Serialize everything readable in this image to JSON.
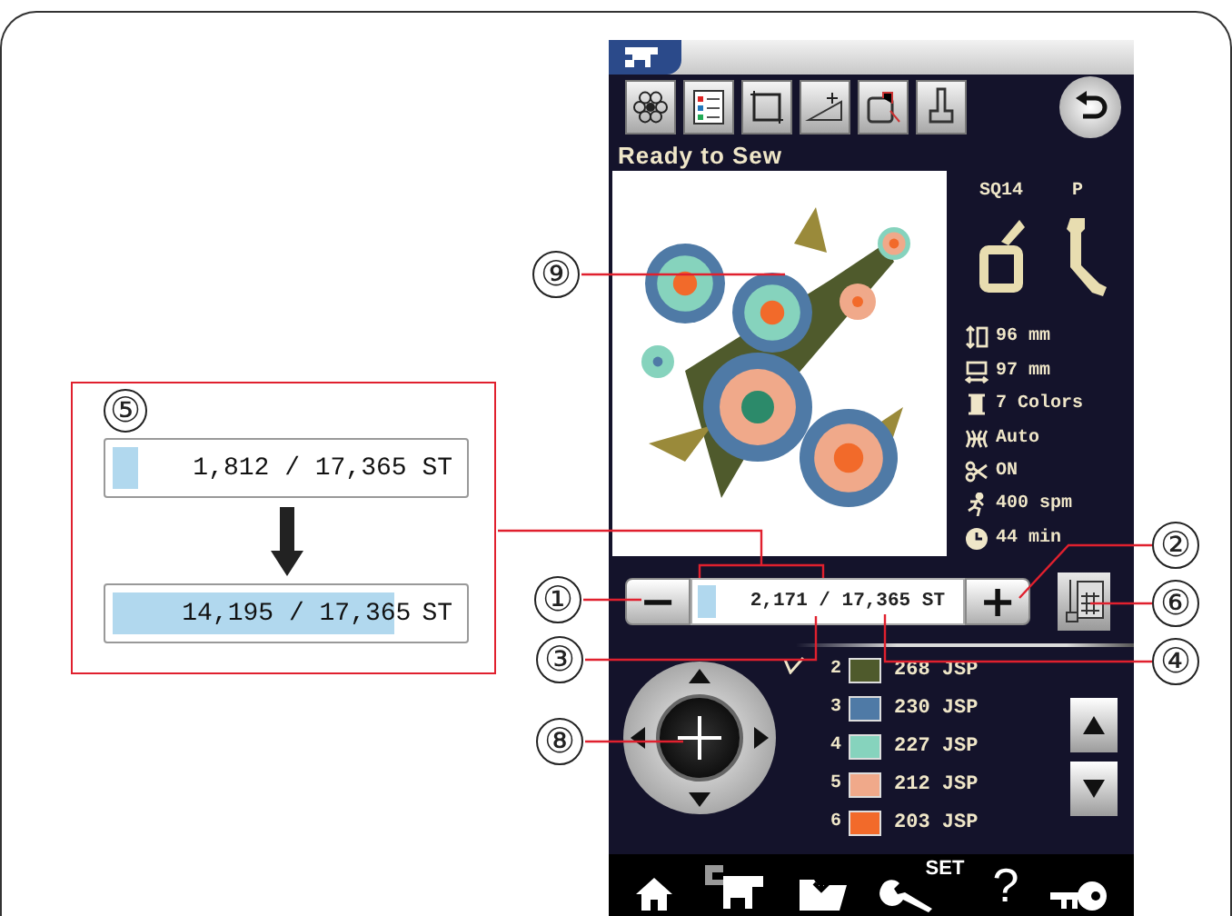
{
  "callout": {
    "label": "⑤",
    "before": {
      "text": "1,812 / 17,365 ST",
      "level": 0.11
    },
    "after": {
      "count": "14,195 / 17,365",
      "unit": "ST",
      "level": 0.82
    }
  },
  "screen": {
    "status": "Ready to Sew",
    "hoop": "SQ14",
    "foot": "P",
    "info": [
      {
        "kind": "height",
        "text": "96 mm"
      },
      {
        "kind": "width",
        "text": "97 mm"
      },
      {
        "kind": "colors",
        "text": "7 Colors"
      },
      {
        "kind": "tension",
        "text": "Auto"
      },
      {
        "kind": "trim",
        "text": "ON"
      },
      {
        "kind": "speed",
        "text": "400 spm"
      },
      {
        "kind": "time",
        "text": "44 min"
      }
    ],
    "counter": {
      "minus": "−",
      "plus": "+",
      "text": "2,171 / 17,365 ST",
      "level": 0.11
    },
    "colors": [
      {
        "number": "2",
        "code": "268 JSP",
        "color": "#4f5a2c"
      },
      {
        "number": "3",
        "code": "230 JSP",
        "color": "#4f7aa6"
      },
      {
        "number": "4",
        "code": "227 JSP",
        "color": "#86d3bd"
      },
      {
        "number": "5",
        "code": "212 JSP",
        "color": "#f0a98a"
      },
      {
        "number": "6",
        "code": "203 JSP",
        "color": "#f26a2a"
      }
    ],
    "bottom_bar": [
      {
        "kind": "home"
      },
      {
        "kind": "machine"
      },
      {
        "kind": "folder"
      },
      {
        "kind": "settings",
        "label": "SET"
      },
      {
        "kind": "help",
        "label": "?"
      },
      {
        "kind": "key"
      }
    ]
  },
  "markers": [
    "⑨",
    "①",
    "③",
    "⑧",
    "②",
    "⑥",
    "④"
  ]
}
